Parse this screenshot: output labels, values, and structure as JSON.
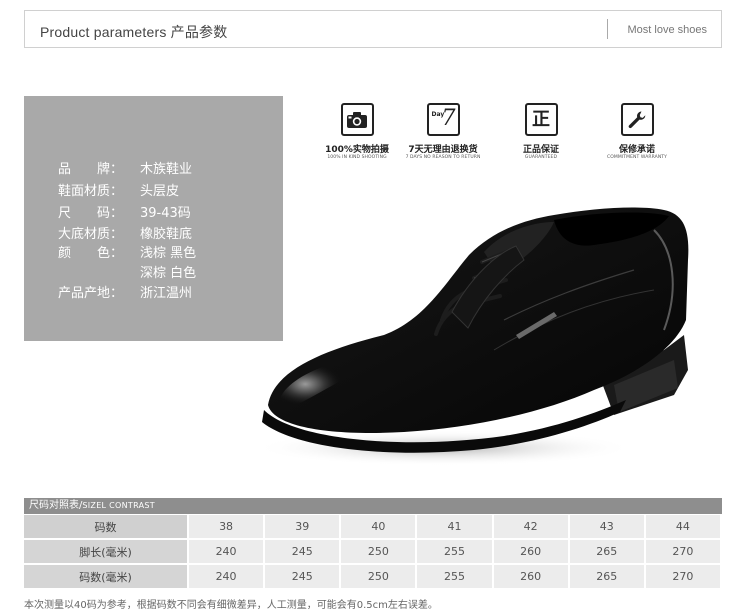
{
  "header": {
    "title": "Product parameters   产品参数",
    "subtitle": "Most love shoes"
  },
  "specs": [
    {
      "label": "品　　牌：",
      "value": "木族鞋业"
    },
    {
      "label": "鞋面材质：",
      "value": "头层皮"
    },
    {
      "label": "尺　　码：",
      "value": "39-43码"
    },
    {
      "label": "大底材质：",
      "value": "橡胶鞋底"
    },
    {
      "label": "颜　　色：",
      "value": "浅棕  黑色"
    },
    {
      "label": "",
      "value": "深棕  白色"
    },
    {
      "label": "产品产地：",
      "value": "浙江温州"
    }
  ],
  "badges": [
    {
      "icon": "camera-icon",
      "glyph": "",
      "title": "100%实物拍摄",
      "sub": "100% IN KIND SHOOTING"
    },
    {
      "icon": "seven-day-icon",
      "glyph": "7",
      "small": "Day",
      "title": "7天无理由退换货",
      "sub": "7 DAYS NO REASON TO RETURN"
    },
    {
      "icon": "guarantee-icon",
      "glyph": "正",
      "title": "正品保证",
      "sub": "GUARANTEED"
    },
    {
      "icon": "wrench-icon",
      "glyph": "",
      "title": "保修承诺",
      "sub": "COMMITMENT WARRANTY"
    }
  ],
  "size_table": {
    "caption_cn": "尺码对照表/",
    "caption_en": "SIZEL CONTRAST",
    "rows": [
      {
        "label": "码数",
        "cells": [
          "38",
          "39",
          "40",
          "41",
          "42",
          "43",
          "44"
        ]
      },
      {
        "label": "脚长(毫米)",
        "cells": [
          "240",
          "245",
          "250",
          "255",
          "260",
          "265",
          "270"
        ]
      },
      {
        "label": "码数(毫米)",
        "cells": [
          "240",
          "245",
          "250",
          "255",
          "260",
          "265",
          "270"
        ]
      }
    ]
  },
  "footnote": "本次测量以40码为参考，根据码数不同会有细微差异，人工测量，可能会有0.5cm左右误差。",
  "colors": {
    "panel_bg": "#a9a9a9",
    "table_header_bg": "#8e8e8e",
    "table_cell_bg": "#ececec"
  }
}
